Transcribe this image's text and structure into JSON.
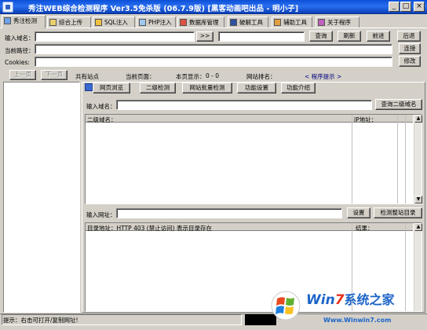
{
  "window": {
    "title": "秀注WEB综合检测程序 Ver3.5免杀版 (06.7.9版) [黑客动画吧出品 - 明小子]",
    "min_label": "_",
    "max_label": "□",
    "close_label": "×"
  },
  "tabs": [
    {
      "label": "秀注检测"
    },
    {
      "label": "综合上传"
    },
    {
      "label": "SQL注入"
    },
    {
      "label": "PHP注入"
    },
    {
      "label": "数据库管理"
    },
    {
      "label": "破解工具"
    },
    {
      "label": "辅助工具"
    },
    {
      "label": "关于程序"
    }
  ],
  "top": {
    "domain_label": "输入域名：",
    "arrow_btn": ">>",
    "query_btn": "查询",
    "refresh_btn": "刷新",
    "forward_btn": "前进",
    "back_btn": "后退",
    "path_label": "当前路径：",
    "connect_btn": "连接",
    "cookies_label": "Cookies:",
    "modify_btn": "修改",
    "prev_page_btn": "上一页",
    "next_page_btn": "下一页",
    "sites_label": "共有站点",
    "current_page_label": "当前页面：",
    "page_show_label": "本页显示：",
    "page_show_value": "0 - 0",
    "site_rank_label": "网站排名：",
    "program_tip_label": "< 程序提示 >"
  },
  "subtabs": [
    {
      "label": "网页浏览"
    },
    {
      "label": "二级检测"
    },
    {
      "label": "网站批量检测"
    },
    {
      "label": "功能设置"
    },
    {
      "label": "功能介绍"
    }
  ],
  "sub_domain": {
    "label": "输入域名：",
    "query_btn": "查询二级域名"
  },
  "grid1": {
    "columns": [
      "二级域名：",
      "IP地址："
    ]
  },
  "url_row": {
    "label": "输入网址：",
    "settings_btn": "设置",
    "detect_btn": "检测整站目录"
  },
  "grid2": {
    "columns": [
      "目录地址：HTTP 403 (禁止访问) 表示目录存在",
      "结果："
    ]
  },
  "status": {
    "text": "提示：右击可打开/复制网址!"
  },
  "watermark": {
    "brand_win": "Win",
    "brand_7": "7",
    "brand_cn": "系统之家",
    "url": "Www.Winwin7.com"
  }
}
